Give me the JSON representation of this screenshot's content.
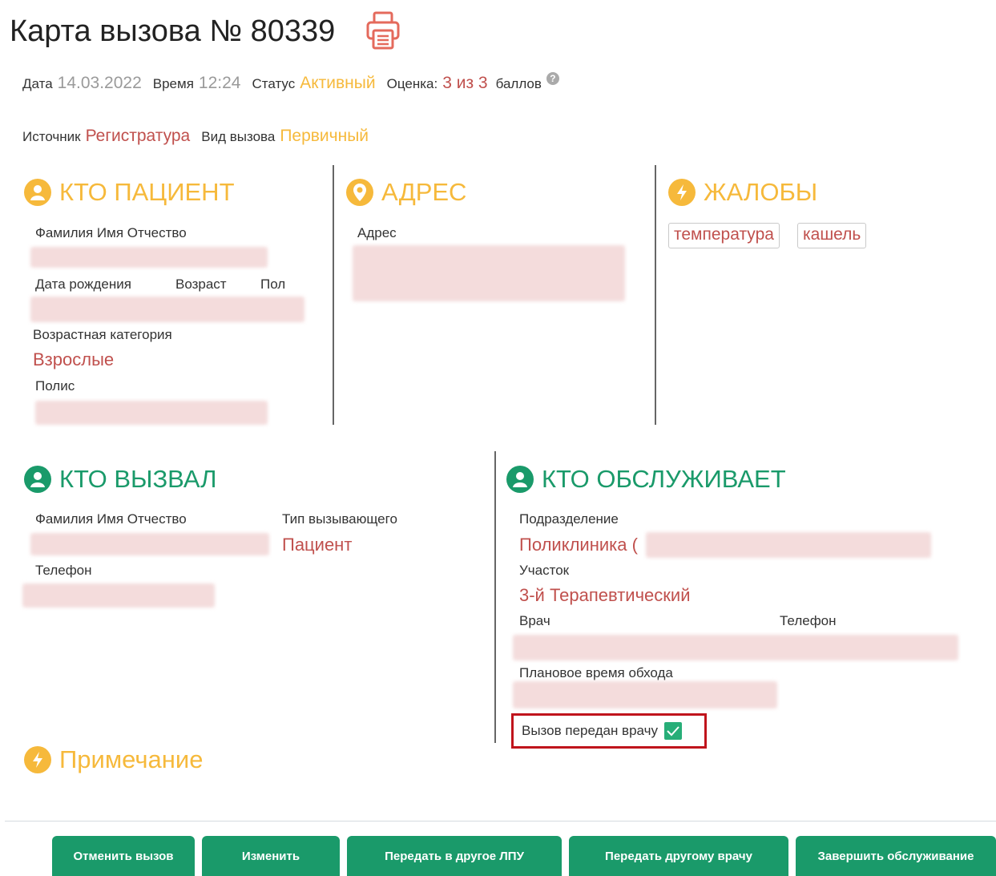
{
  "header": {
    "title": "Карта вызова № 80339",
    "date_label": "Дата",
    "date_value": "14.03.2022",
    "time_label": "Время",
    "time_value": "12:24",
    "status_label": "Статус",
    "status_value": "Активный",
    "score_label": "Оценка:",
    "score_value": "3 из 3",
    "score_suffix": "баллов",
    "source_label": "Источник",
    "source_value": "Регистратура",
    "call_type_label": "Вид вызова",
    "call_type_value": "Первичный"
  },
  "patient": {
    "heading": "КТО ПАЦИЕНТ",
    "fio_label": "Фамилия Имя Отчество",
    "birth_label": "Дата рождения",
    "age_label": "Возраст",
    "sex_label": "Пол",
    "age_category_label": "Возрастная категория",
    "age_category_value": "Взрослые",
    "policy_label": "Полис"
  },
  "address": {
    "heading": "АДРЕС",
    "address_label": "Адрес"
  },
  "complaints": {
    "heading": "ЖАЛОБЫ",
    "tags": [
      "температура",
      "кашель"
    ]
  },
  "caller": {
    "heading": "КТО ВЫЗВАЛ",
    "fio_label": "Фамилия Имя Отчество",
    "caller_type_label": "Тип вызывающего",
    "caller_type_value": "Пациент",
    "phone_label": "Телефон"
  },
  "service": {
    "heading": "КТО ОБСЛУЖИВАЕТ",
    "division_label": "Подразделение",
    "division_value": "Поликлиника (",
    "area_label": "Участок",
    "area_value": "3-й Терапевтический",
    "doctor_label": "Врач",
    "phone_label": "Телефон",
    "planned_time_label": "Плановое время обхода",
    "passed_to_doctor_label": "Вызов передан врачу",
    "passed_to_doctor_checked": true
  },
  "notes": {
    "heading": "Примечание"
  },
  "actions": {
    "cancel": "Отменить вызов",
    "edit": "Изменить",
    "transfer_lpu": "Передать в другое ЛПУ",
    "transfer_doctor": "Передать другому врачу",
    "finish": "Завершить обслуживание"
  },
  "colors": {
    "accent_orange": "#f6b93b",
    "accent_red": "#c0504d",
    "accent_green": "#1a9a6a",
    "highlight_border": "#c0141c"
  },
  "icons": {
    "print": "printer-icon",
    "user": "user-icon",
    "location": "location-pin-icon",
    "lightning": "lightning-icon",
    "help": "question-icon",
    "check": "check-icon"
  }
}
